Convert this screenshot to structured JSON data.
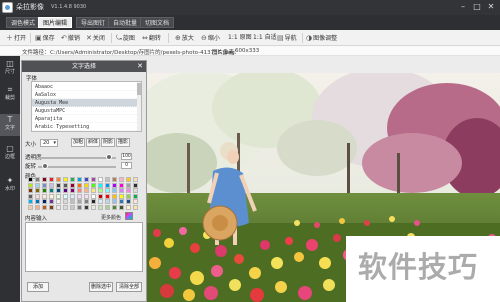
{
  "app": {
    "title": "朵拉影像",
    "version": "V1.1.4.8 9030"
  },
  "tabs": [
    {
      "label": "调色模式"
    },
    {
      "label": "图片编辑",
      "active": true
    },
    {
      "label": "导出图钉"
    },
    {
      "label": "自动批量"
    },
    {
      "label": "切图文档"
    }
  ],
  "toolbar": [
    {
      "icon": "＋",
      "label": "打开"
    },
    {
      "icon": "▣",
      "label": "保存"
    },
    {
      "icon": "↶",
      "label": "撤销"
    },
    {
      "icon": "✕",
      "label": "关闭"
    },
    {
      "icon": "⤿",
      "label": "旋图"
    },
    {
      "icon": "⇔",
      "label": "翻转"
    },
    {
      "icon": "⊕",
      "label": "放大"
    },
    {
      "icon": "⊖",
      "label": "缩小"
    },
    {
      "icon": "",
      "label": "1:1 原图"
    },
    {
      "icon": "",
      "label": "1:1 自适"
    },
    {
      "icon": "▤",
      "label": "导航"
    },
    {
      "icon": "◑",
      "label": "图像调整"
    }
  ],
  "path": {
    "label": "文件路径：",
    "value": "C:/Users/Administrator/Desktop/存图片的/pexels-photo-413735.jpeg",
    "size_label": "图片像素：",
    "size_value": "600x333"
  },
  "rail": [
    {
      "icon": "◫",
      "label": "尺寸"
    },
    {
      "icon": "⌗",
      "label": "裁剪"
    },
    {
      "icon": "T",
      "label": "文字",
      "active": true
    },
    {
      "icon": "▢",
      "label": "边框"
    },
    {
      "icon": "✦",
      "label": "水印"
    }
  ],
  "panel": {
    "title": "文字选择",
    "font_label": "字体",
    "fonts": [
      "Abaaoc",
      "AaSalox",
      "Augusta Mee",
      "AugustaMPC",
      "Aparajita",
      "Arabic Typesetting"
    ],
    "selected_font_index": 2,
    "size_label": "大小",
    "size_value": "20",
    "style_buttons": [
      "加粗",
      "斜体",
      "阴影",
      "描影"
    ],
    "opacity_label": "透明度",
    "opacity_value": "100",
    "opacity_level": 0.95,
    "rotate_label": "旋转",
    "rotate_value": "0",
    "rotate_level": 0.05,
    "color_label": "颜色",
    "palette": [
      "#000000",
      "#7f7f7f",
      "#880015",
      "#ed1c24",
      "#ff7f27",
      "#fff200",
      "#22b14c",
      "#00a2e8",
      "#3f48cc",
      "#a349a4",
      "#ffffff",
      "#c3c3c3",
      "#b97a57",
      "#ffaec9",
      "#ffc90e",
      "#efe4b0",
      "#b5e61d",
      "#99d9ea",
      "#7092be",
      "#c8bfe7",
      "#404040",
      "#595959",
      "#990030",
      "#ff6a00",
      "#ffd800",
      "#4cff00",
      "#00ffff",
      "#0094ff",
      "#b200ff",
      "#ff00dc",
      "#a0a0a0",
      "#303030",
      "#7f3300",
      "#7f6a00",
      "#267f00",
      "#007f7f",
      "#004a7f",
      "#57007f",
      "#7f006e",
      "#ff7f7f",
      "#ffb27f",
      "#ffe97f",
      "#a5ff7f",
      "#7fffff",
      "#7fc9ff",
      "#d67fff",
      "#ff7fed",
      "#dadada",
      "#606060",
      "#ffd8d8",
      "#ffe8d8",
      "#fff6d8",
      "#e4ffd8",
      "#d8ffff",
      "#d8ecff",
      "#f0d8ff",
      "#ffd8f8",
      "#ffffff",
      "#c00000",
      "#ff0000",
      "#ffc000",
      "#ffff00",
      "#92d050",
      "#00b050",
      "#00b0f0",
      "#0070c0",
      "#002060",
      "#7030a0",
      "#f2f2f2",
      "#d9d9d9",
      "#bfbfbf",
      "#a6a6a6",
      "#808080",
      "#262626",
      "#ddebf7",
      "#bdd7ee",
      "#9bc2e6",
      "#2f75b5",
      "#1f4e78",
      "#fce4d6",
      "#f8cbad",
      "#f4b084",
      "#c65911",
      "#833c0c",
      "#ededed",
      "#dbdbdb",
      "#c9c9c9",
      "#7b7b7b",
      "#3a3a3a",
      "#e2efda",
      "#c6e0b4",
      "#a9d08e",
      "#548235",
      "#375623",
      "#fff2cc",
      "#ffe699"
    ],
    "content_label": "内容输入",
    "more_colors_label": "更多颜色",
    "buttons": [
      "添加",
      "删除选中",
      "清除全部"
    ]
  },
  "watermark_text": "软件技巧"
}
